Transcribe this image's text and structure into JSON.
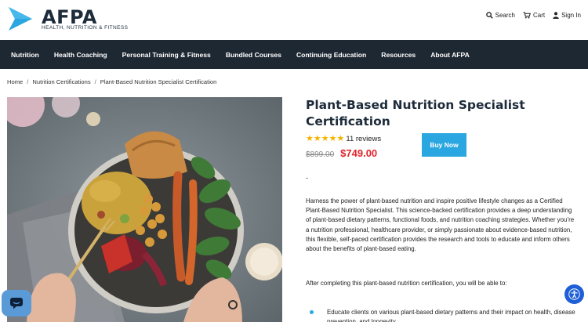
{
  "brand": {
    "name": "AFPA",
    "tagline": "HEALTH, NUTRITION & FITNESS",
    "accent": "#2aa6e0"
  },
  "header_utils": [
    {
      "icon": "search-icon",
      "label": "Search"
    },
    {
      "icon": "cart-icon",
      "label": "Cart"
    },
    {
      "icon": "user-icon",
      "label": "Sign In"
    }
  ],
  "nav": [
    "Nutrition",
    "Health Coaching",
    "Personal Training & Fitness",
    "Bundled Courses",
    "Continuing Education",
    "Resources",
    "About AFPA"
  ],
  "breadcrumb": [
    "Home",
    "Nutrition Certifications",
    "Plant-Based Nutrition Specialist Certification"
  ],
  "product": {
    "title_line1": "Plant-Based Nutrition Specialist",
    "title_line2": "Certification",
    "rating_stars": 5,
    "reviews": "11 reviews",
    "old_price": "$899.00",
    "new_price": "$749.00",
    "buy_label": "Buy Now",
    "dash": "-",
    "description": "Harness the power of plant-based nutrition and inspire positive lifestyle changes as a Certified Plant-Based Nutrition Specialist. This science-backed certification provides a deep understanding of plant-based dietary patterns, functional foods, and nutrition coaching strategies. Whether you’re a nutrition professional, healthcare provider, or simply passionate about evidence-based nutrition, this flexible, self-paced certification provides the research and tools to educate and inform others about the benefits of plant-based eating.",
    "after_text": "After completing this plant-based nutrition certification, you will be able to:",
    "bullets": [
      "Educate clients on various plant-based dietary patterns and their impact on health, disease prevention, and longevity."
    ]
  },
  "colors": {
    "nav_bg": "#1e2833",
    "price_red": "#e2232a",
    "star": "#f5b301"
  }
}
